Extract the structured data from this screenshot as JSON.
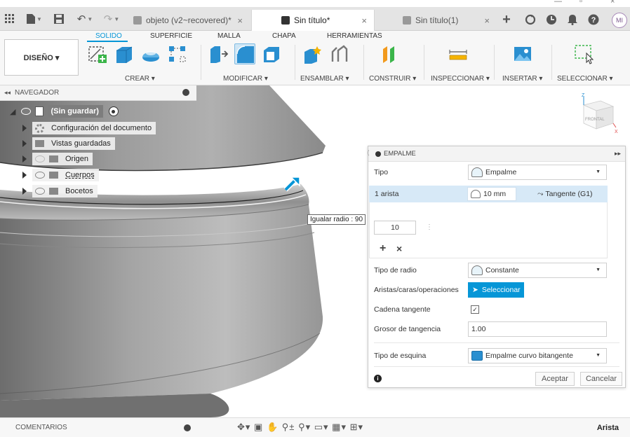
{
  "tabs": {
    "tab1_label": "objeto (v2~recovered)*",
    "tab2_label": "Sin título*",
    "tab3_label": "Sin título(1)",
    "close_glyph": "×"
  },
  "user": {
    "initials": "MI"
  },
  "ribbon": {
    "tabs": [
      "SOLIDO",
      "SUPERFICIE",
      "MALLA",
      "CHAPA",
      "HERRAMIENTAS"
    ],
    "workspace": "DISEÑO ▾",
    "groups": [
      "CREAR ▾",
      "MODIFICAR ▾",
      "ENSAMBLAR ▾",
      "CONSTRUIR ▾",
      "INSPECCIONAR ▾",
      "INSERTAR ▾",
      "SELECCIONAR ▾"
    ]
  },
  "navigator": {
    "title": "NAVEGADOR",
    "root": "(Sin guardar)",
    "items": [
      "Configuración del documento",
      "Vistas guardadas",
      "Origen",
      "Cuerpos",
      "Bocetos"
    ]
  },
  "viewcube": {
    "face": "FRONTAL",
    "z": "Z",
    "x": "X"
  },
  "tooltip": "Igualar radio : 90",
  "empalme": {
    "title": "EMPALME",
    "tipo_label": "Tipo",
    "tipo_value": "Empalme",
    "arista_count": "1 arista",
    "radius": "10 mm",
    "continuity": "Tangente (G1)",
    "list_value": "10",
    "tipo_radio_label": "Tipo de radio",
    "tipo_radio_value": "Constante",
    "aristas_label": "Aristas/caras/operaciones",
    "seleccionar": "Seleccionar",
    "cadena_label": "Cadena tangente",
    "cadena_checked": "✓",
    "grosor_label": "Grosor de tangencia",
    "grosor_value": "1.00",
    "esquina_label": "Tipo de esquina",
    "esquina_value": "Empalme curvo bitangente",
    "aceptar": "Aceptar",
    "cancelar": "Cancelar"
  },
  "bottom": {
    "comments": "COMENTARIOS",
    "status": "Arista"
  }
}
